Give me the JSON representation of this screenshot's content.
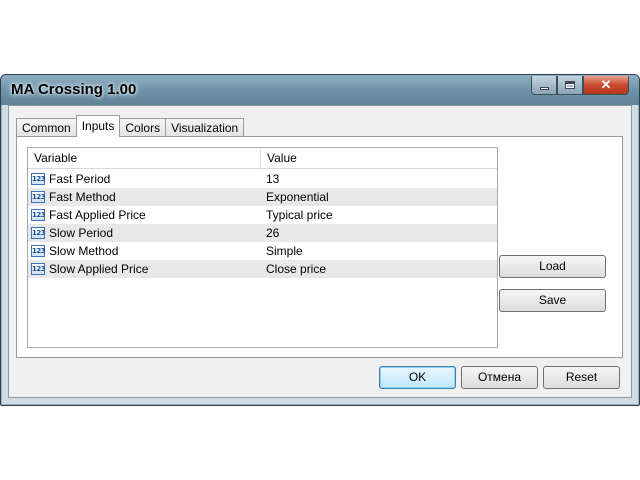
{
  "window": {
    "title": "MA Crossing 1.00"
  },
  "tabs": [
    {
      "label": "Common",
      "active": false
    },
    {
      "label": "Inputs",
      "active": true
    },
    {
      "label": "Colors",
      "active": false
    },
    {
      "label": "Visualization",
      "active": false
    }
  ],
  "grid": {
    "columns": [
      "Variable",
      "Value"
    ],
    "icon_text": "123",
    "rows": [
      {
        "variable": "Fast Period",
        "value": "13"
      },
      {
        "variable": "Fast Method",
        "value": "Exponential"
      },
      {
        "variable": "Fast Applied Price",
        "value": "Typical price"
      },
      {
        "variable": "Slow Period",
        "value": "26"
      },
      {
        "variable": "Slow Method",
        "value": "Simple"
      },
      {
        "variable": "Slow Applied Price",
        "value": "Close price"
      }
    ]
  },
  "buttons": {
    "load": "Load",
    "save": "Save",
    "ok": "OK",
    "cancel": "Отмена",
    "reset": "Reset",
    "close_glyph": "✕"
  }
}
